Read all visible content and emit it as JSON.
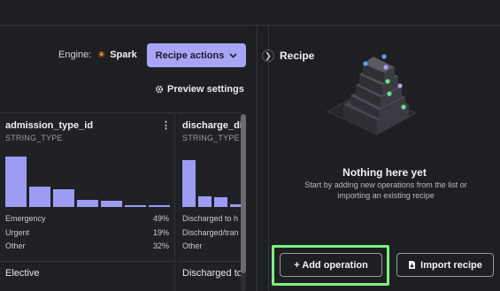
{
  "toolbar": {
    "engine_label": "Engine:",
    "engine_value": "Spark",
    "recipe_actions_label": "Recipe actions",
    "preview_settings_label": "Preview settings"
  },
  "columns": [
    {
      "name": "admission_type_id",
      "type": "STRING_TYPE",
      "histogram": [
        0.95,
        0.38,
        0.34,
        0.14,
        0.11,
        0.03,
        0.03
      ],
      "stats": [
        {
          "label": "Emergency",
          "pct": "49%"
        },
        {
          "label": "Urgent",
          "pct": "19%"
        },
        {
          "label": "Other",
          "pct": "32%"
        }
      ],
      "first_value": "Elective"
    },
    {
      "name": "discharge_dis",
      "type": "STRING_TYPE",
      "histogram": [
        0.88,
        0.2,
        0.18,
        0.05
      ],
      "stats": [
        {
          "label": "Discharged to h"
        },
        {
          "label": "Discharged/tran"
        },
        {
          "label": "Other"
        }
      ],
      "first_value": "Discharged to"
    }
  ],
  "recipe": {
    "title": "Recipe",
    "empty_title": "Nothing here yet",
    "empty_subtitle": "Start by adding new operations from the list or importing an existing recipe",
    "add_operation_label": "+ Add operation",
    "import_recipe_label": "Import recipe"
  },
  "colors": {
    "accent": "#a7a6f6",
    "histogram_bar": "#9c9cf2",
    "highlight": "#7cf07c",
    "engine_icon": "#f08a24"
  },
  "icons": {
    "engine": "spark-icon",
    "recipe_actions": "chevron-down-icon",
    "preview_settings": "gear-icon",
    "column_menu": "kebab-menu-icon",
    "collapse_panel": "chevron-right-icon",
    "import_recipe": "file-import-icon"
  }
}
